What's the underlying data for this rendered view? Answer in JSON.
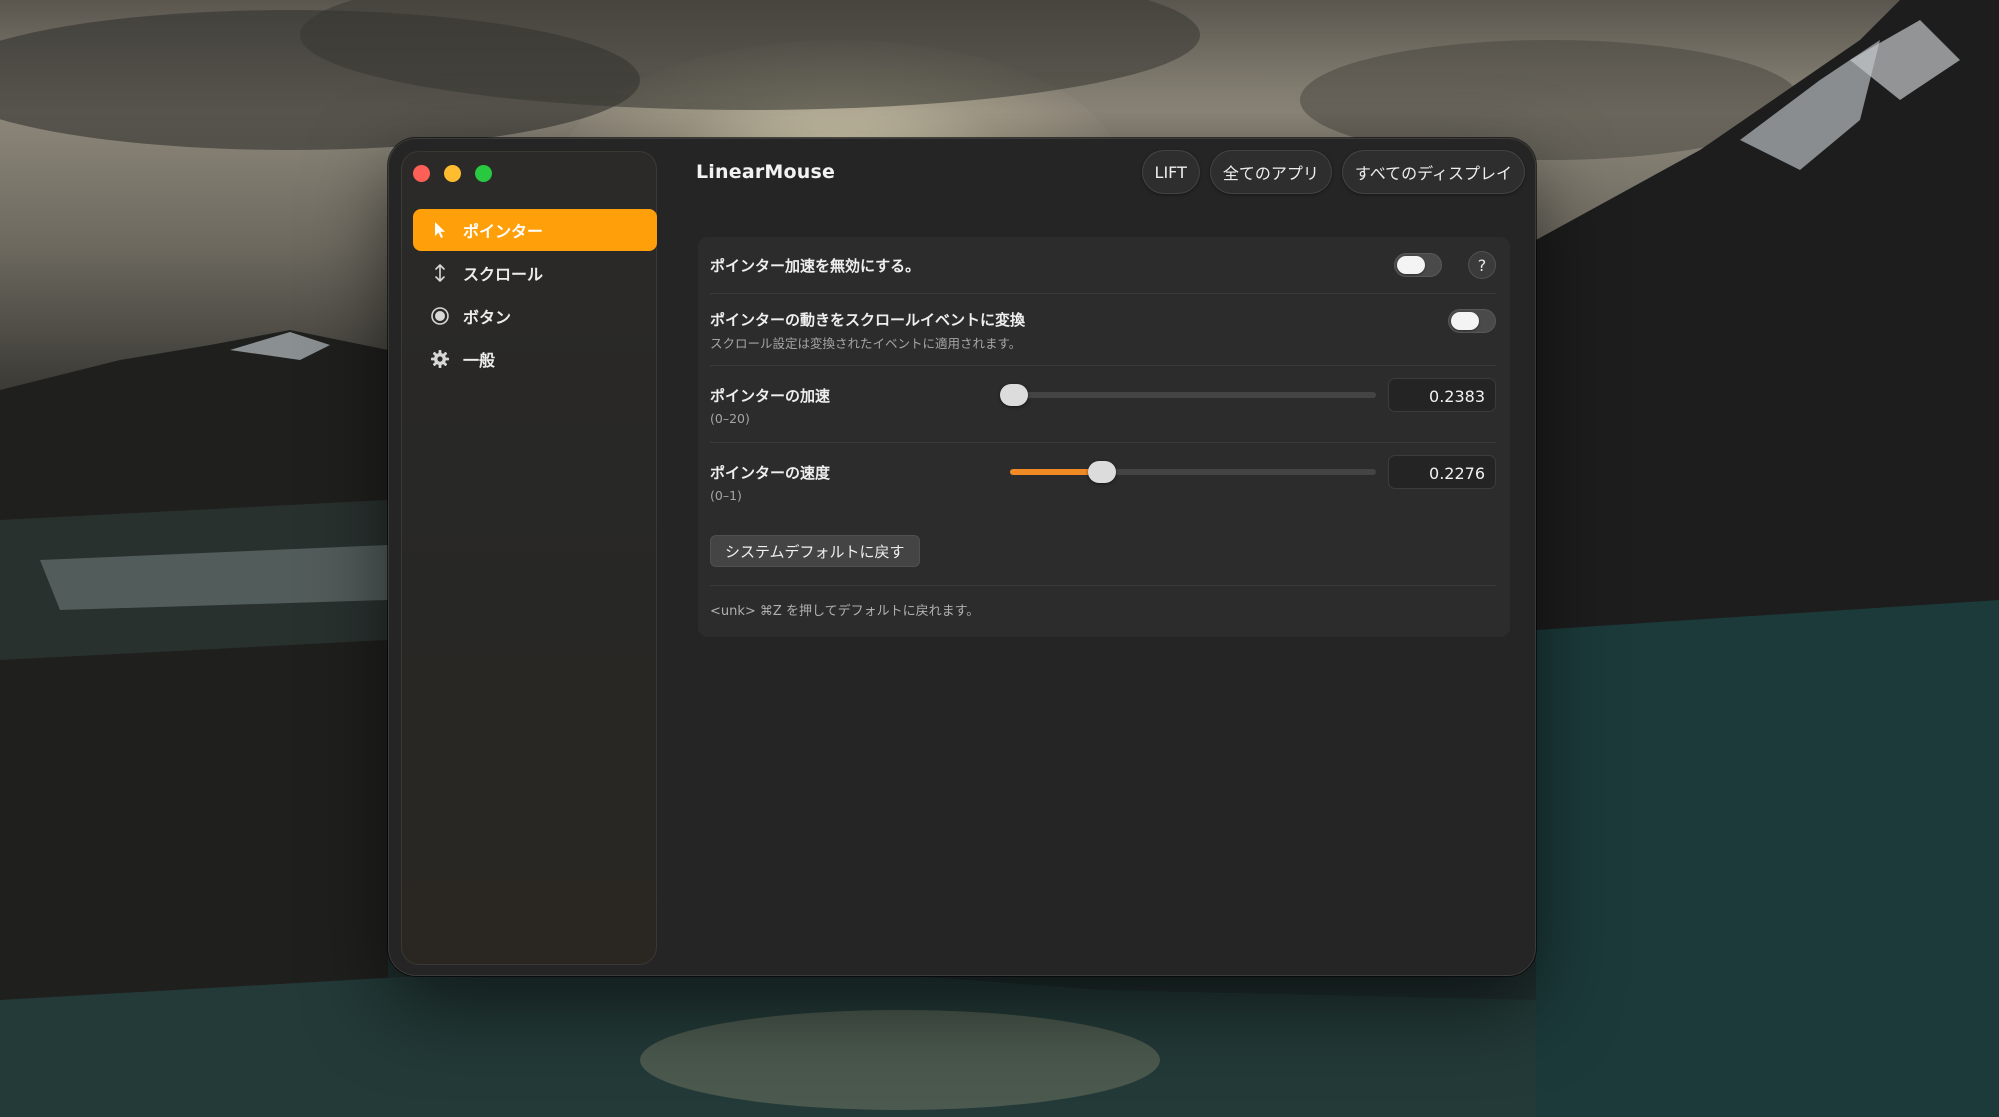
{
  "app": {
    "title": "LinearMouse"
  },
  "window_controls": [
    "close",
    "minimize",
    "zoom"
  ],
  "toolbar": {
    "device_label": "LIFT",
    "app_scope_label": "全てのアプリ",
    "display_scope_label": "すべてのディスプレイ"
  },
  "sidebar": {
    "items": [
      {
        "label": "ポインター",
        "icon": "pointer-arrow-icon",
        "active": true
      },
      {
        "label": "スクロール",
        "icon": "scroll-arrows-icon",
        "active": false
      },
      {
        "label": "ボタン",
        "icon": "button-circle-icon",
        "active": false
      },
      {
        "label": "一般",
        "icon": "gear-icon",
        "active": false
      }
    ]
  },
  "pointer": {
    "disable_acceleration": {
      "label": "ポインター加速を無効にする。",
      "enabled": false,
      "help": "?"
    },
    "convert_to_scroll": {
      "label": "ポインターの動きをスクロールイベントに変換",
      "description": "スクロール設定は変換されたイベントに適用されます。",
      "enabled": false
    },
    "acceleration": {
      "label": "ポインターの加速",
      "range": "(0–20)",
      "value": "0.2383",
      "fraction": 0.012
    },
    "speed": {
      "label": "ポインターの速度",
      "range": "(0–1)",
      "value": "0.2276",
      "fraction": 0.25
    },
    "reset_label": "システムデフォルトに戻す",
    "hint": "<unk> ⌘Z を押してデフォルトに戻れます。"
  },
  "colors": {
    "accent": "#ff9f0a",
    "slider_fill": "#f08a24",
    "window_bg": "#252525"
  }
}
